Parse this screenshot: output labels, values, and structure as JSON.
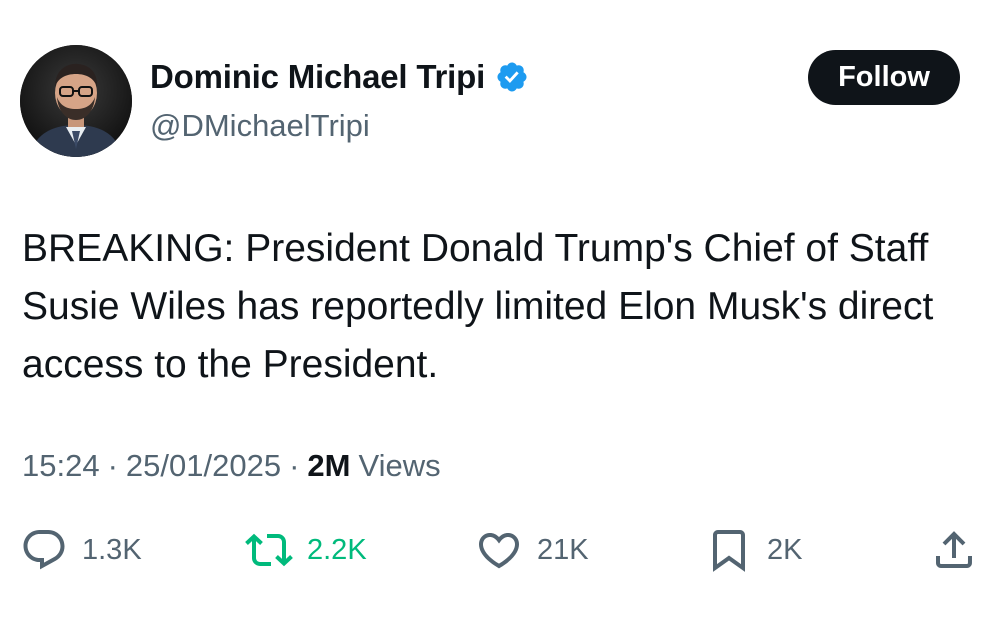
{
  "author": {
    "display_name": "Dominic Michael Tripi",
    "handle": "@DMichaelTripi",
    "verified": true
  },
  "follow_label": "Follow",
  "tweet": {
    "text": "BREAKING: President Donald Trump's Chief of Staff Susie Wiles has reportedly limited Elon Musk's direct access to the President.",
    "time": "15:24",
    "date": "25/01/2025",
    "views_count": "2M",
    "views_label": "Views"
  },
  "actions": {
    "replies": "1.3K",
    "retweets": "2.2K",
    "likes": "21K",
    "bookmarks": "2K"
  },
  "colors": {
    "text_primary": "#0f1419",
    "text_secondary": "#536471",
    "verified_blue": "#1d9bf0",
    "retweet_green": "#00ba7c",
    "follow_bg": "#0f1419"
  },
  "icons": {
    "verified": "verified-badge-icon",
    "reply": "reply-icon",
    "retweet": "retweet-icon",
    "like": "heart-icon",
    "bookmark": "bookmark-icon",
    "share": "share-icon"
  }
}
